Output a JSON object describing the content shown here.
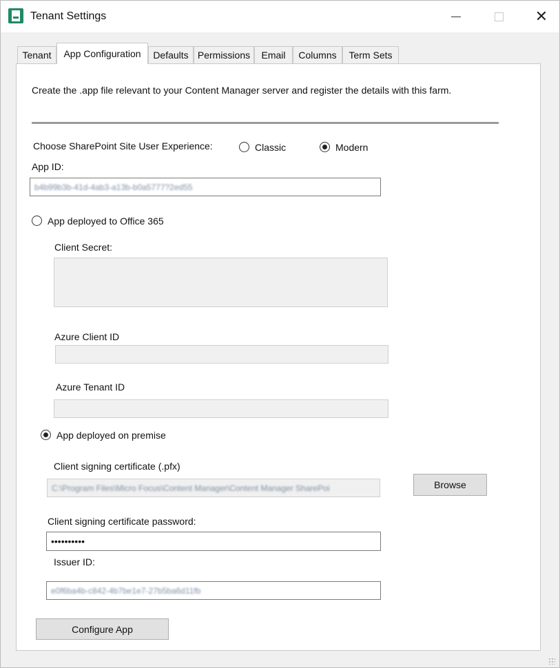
{
  "window": {
    "title": "Tenant Settings"
  },
  "tabs": [
    {
      "label": "Tenant",
      "active": false
    },
    {
      "label": "App Configuration",
      "active": true
    },
    {
      "label": "Defaults",
      "active": false
    },
    {
      "label": "Permissions",
      "active": false
    },
    {
      "label": "Email",
      "active": false
    },
    {
      "label": "Columns",
      "active": false
    },
    {
      "label": "Term Sets",
      "active": false
    }
  ],
  "form": {
    "description": "Create the .app file relevant to your Content Manager server and register the details with this farm.",
    "experience": {
      "label": "Choose SharePoint Site User Experience:",
      "options": [
        {
          "label": "Classic",
          "selected": false
        },
        {
          "label": "Modern",
          "selected": true
        }
      ]
    },
    "app_id": {
      "label": "App ID:",
      "value": "b4b99b3b-41d-4ab3-a13b-b0a5777?2ed55"
    },
    "office365": {
      "label": "App deployed to Office 365",
      "selected": false,
      "client_secret_label": "Client Secret:",
      "azure_client_id_label": "Azure Client ID",
      "azure_tenant_id_label": "Azure Tenant ID"
    },
    "on_premise": {
      "label": "App deployed on premise",
      "selected": true,
      "cert_label": "Client signing certificate (.pfx)",
      "cert_value": "C:\\Program Files\\Micro Focus\\Content Manager\\Content Manager SharePoi",
      "browse_label": "Browse",
      "password_label": "Client signing certificate password:",
      "password_value": "••••••••••",
      "issuer_label": "Issuer ID:",
      "issuer_value": "e0f6ba4b-c842-4b7be1e7-27b5ba6d11fb"
    },
    "configure_label": "Configure App"
  },
  "colors": {
    "window_bg": "#f0f0f0",
    "panel_bg": "#ffffff",
    "icon_green": "#1f8a63"
  },
  "icons": [
    "app-icon",
    "minimize-icon",
    "maximize-icon",
    "close-icon"
  ]
}
